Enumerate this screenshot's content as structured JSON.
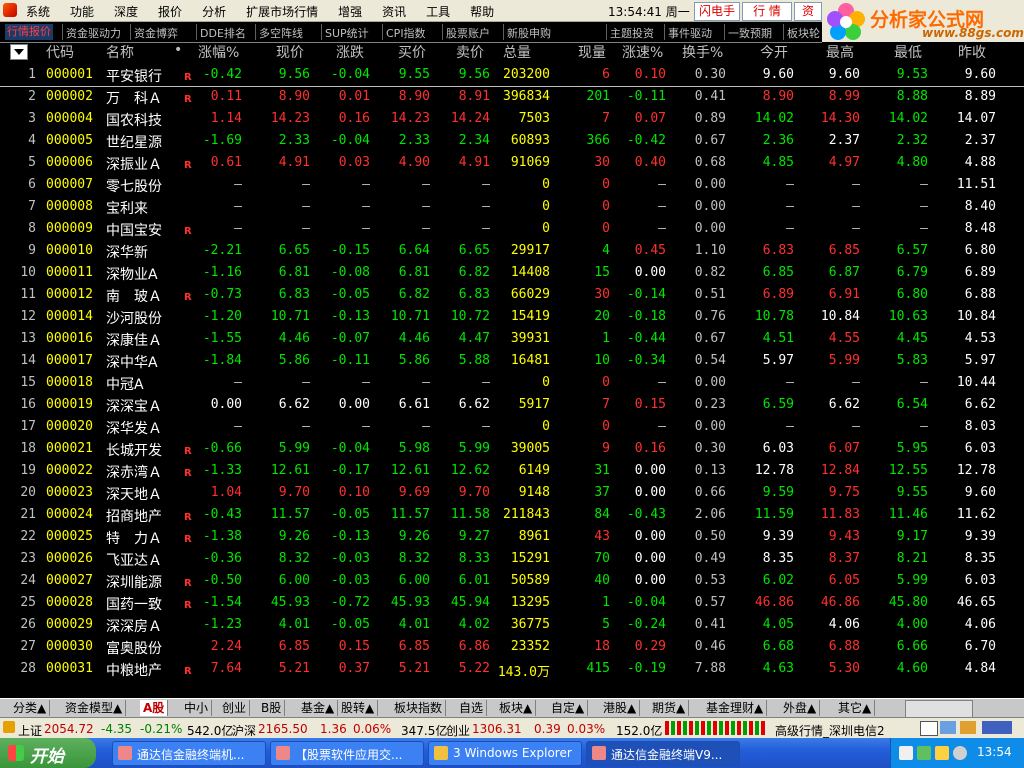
{
  "app": {
    "menu": [
      "系统",
      "功能",
      "深度",
      "报价",
      "分析",
      "扩展市场行情",
      "增强",
      "资讯",
      "工具",
      "帮助"
    ],
    "clock": "13:54:41 周一",
    "quick_buttons": [
      "闪电手",
      "行 情",
      "资"
    ],
    "brand_title": "分析家公式网",
    "brand_url": "www.88gs.com"
  },
  "subtabs": [
    {
      "label": "行情报价",
      "active": true
    },
    {
      "label": "资金驱动力"
    },
    {
      "label": "资金博弈"
    },
    {
      "label": "DDE排名"
    },
    {
      "label": "多空阵线"
    },
    {
      "label": "SUP统计"
    },
    {
      "label": "CPI指数"
    },
    {
      "label": "股票账户"
    },
    {
      "label": "新股申购"
    },
    {
      "label": "主题投资"
    },
    {
      "label": "事件驱动"
    },
    {
      "label": "一致预期"
    },
    {
      "label": "板块轮"
    }
  ],
  "columns": [
    "代码",
    "名称",
    "•",
    "涨幅%",
    "现价",
    "涨跌",
    "买价",
    "卖价",
    "总量",
    "现量",
    "涨速%",
    "换手%",
    "今开",
    "最高",
    "最低",
    "昨收"
  ],
  "rows": [
    {
      "no": "1",
      "code": "000001",
      "name": "平安银行",
      "r": true,
      "chg_pct": "-0.42",
      "price": "9.56",
      "chg": "-0.04",
      "bid": "9.55",
      "ask": "9.56",
      "vol": "203200",
      "cur": "6",
      "speed": "0.10",
      "turn": "0.30",
      "open": "9.60",
      "high": "9.60",
      "low": "9.53",
      "prev": "9.60",
      "dir": "dn",
      "open_c": "eq",
      "high_c": "eq",
      "low_c": "dn",
      "cur_c": "up",
      "speed_c": "up",
      "selected": true
    },
    {
      "no": "2",
      "code": "000002",
      "name": "万　科Ａ",
      "r": true,
      "chg_pct": "0.11",
      "price": "8.90",
      "chg": "0.01",
      "bid": "8.90",
      "ask": "8.91",
      "vol": "396834",
      "cur": "201",
      "speed": "-0.11",
      "turn": "0.41",
      "open": "8.90",
      "high": "8.99",
      "low": "8.88",
      "prev": "8.89",
      "dir": "up",
      "open_c": "up",
      "high_c": "up",
      "low_c": "dn",
      "cur_c": "dn",
      "speed_c": "dn"
    },
    {
      "no": "3",
      "code": "000004",
      "name": "国农科技",
      "r": false,
      "chg_pct": "1.14",
      "price": "14.23",
      "chg": "0.16",
      "bid": "14.23",
      "ask": "14.24",
      "vol": "7503",
      "cur": "7",
      "speed": "0.07",
      "turn": "0.89",
      "open": "14.02",
      "high": "14.30",
      "low": "14.02",
      "prev": "14.07",
      "dir": "up",
      "open_c": "dn",
      "high_c": "up",
      "low_c": "dn",
      "cur_c": "up",
      "speed_c": "up"
    },
    {
      "no": "4",
      "code": "000005",
      "name": "世纪星源",
      "r": false,
      "chg_pct": "-1.69",
      "price": "2.33",
      "chg": "-0.04",
      "bid": "2.33",
      "ask": "2.34",
      "vol": "60893",
      "cur": "366",
      "speed": "-0.42",
      "turn": "0.67",
      "open": "2.36",
      "high": "2.37",
      "low": "2.32",
      "prev": "2.37",
      "dir": "dn",
      "open_c": "dn",
      "high_c": "eq",
      "low_c": "dn",
      "cur_c": "dn",
      "speed_c": "dn"
    },
    {
      "no": "5",
      "code": "000006",
      "name": "深振业Ａ",
      "r": true,
      "chg_pct": "0.61",
      "price": "4.91",
      "chg": "0.03",
      "bid": "4.90",
      "ask": "4.91",
      "vol": "91069",
      "cur": "30",
      "speed": "0.40",
      "turn": "0.68",
      "open": "4.85",
      "high": "4.97",
      "low": "4.80",
      "prev": "4.88",
      "dir": "up",
      "open_c": "dn",
      "high_c": "up",
      "low_c": "dn",
      "cur_c": "up",
      "speed_c": "up"
    },
    {
      "no": "6",
      "code": "000007",
      "name": "零七股份",
      "r": false,
      "chg_pct": "–",
      "price": "–",
      "chg": "–",
      "bid": "–",
      "ask": "–",
      "vol": "0",
      "cur": "0",
      "speed": "–",
      "turn": "0.00",
      "open": "–",
      "high": "–",
      "low": "–",
      "prev": "11.51",
      "dir": "na",
      "cur_c": "up"
    },
    {
      "no": "7",
      "code": "000008",
      "name": "宝利来",
      "r": false,
      "chg_pct": "–",
      "price": "–",
      "chg": "–",
      "bid": "–",
      "ask": "–",
      "vol": "0",
      "cur": "0",
      "speed": "–",
      "turn": "0.00",
      "open": "–",
      "high": "–",
      "low": "–",
      "prev": "8.40",
      "dir": "na",
      "cur_c": "up"
    },
    {
      "no": "8",
      "code": "000009",
      "name": "中国宝安",
      "r": true,
      "chg_pct": "–",
      "price": "–",
      "chg": "–",
      "bid": "–",
      "ask": "–",
      "vol": "0",
      "cur": "0",
      "speed": "–",
      "turn": "0.00",
      "open": "–",
      "high": "–",
      "low": "–",
      "prev": "8.48",
      "dir": "na",
      "cur_c": "up"
    },
    {
      "no": "9",
      "code": "000010",
      "name": "深华新",
      "r": false,
      "chg_pct": "-2.21",
      "price": "6.65",
      "chg": "-0.15",
      "bid": "6.64",
      "ask": "6.65",
      "vol": "29917",
      "cur": "4",
      "speed": "0.45",
      "turn": "1.10",
      "open": "6.83",
      "high": "6.85",
      "low": "6.57",
      "prev": "6.80",
      "dir": "dn",
      "open_c": "up",
      "high_c": "up",
      "low_c": "dn",
      "cur_c": "dn",
      "speed_c": "up"
    },
    {
      "no": "10",
      "code": "000011",
      "name": "深物业A",
      "r": false,
      "chg_pct": "-1.16",
      "price": "6.81",
      "chg": "-0.08",
      "bid": "6.81",
      "ask": "6.82",
      "vol": "14408",
      "cur": "15",
      "speed": "0.00",
      "turn": "0.82",
      "open": "6.85",
      "high": "6.87",
      "low": "6.79",
      "prev": "6.89",
      "dir": "dn",
      "open_c": "dn",
      "high_c": "dn",
      "low_c": "dn",
      "cur_c": "dn",
      "speed_c": "eq"
    },
    {
      "no": "11",
      "code": "000012",
      "name": "南　玻Ａ",
      "r": true,
      "chg_pct": "-0.73",
      "price": "6.83",
      "chg": "-0.05",
      "bid": "6.82",
      "ask": "6.83",
      "vol": "66029",
      "cur": "30",
      "speed": "-0.14",
      "turn": "0.51",
      "open": "6.89",
      "high": "6.91",
      "low": "6.80",
      "prev": "6.88",
      "dir": "dn",
      "open_c": "up",
      "high_c": "up",
      "low_c": "dn",
      "cur_c": "up",
      "speed_c": "dn"
    },
    {
      "no": "12",
      "code": "000014",
      "name": "沙河股份",
      "r": false,
      "chg_pct": "-1.20",
      "price": "10.71",
      "chg": "-0.13",
      "bid": "10.71",
      "ask": "10.72",
      "vol": "15419",
      "cur": "20",
      "speed": "-0.18",
      "turn": "0.76",
      "open": "10.78",
      "high": "10.84",
      "low": "10.63",
      "prev": "10.84",
      "dir": "dn",
      "open_c": "dn",
      "high_c": "eq",
      "low_c": "dn",
      "cur_c": "dn",
      "speed_c": "dn"
    },
    {
      "no": "13",
      "code": "000016",
      "name": "深康佳Ａ",
      "r": false,
      "chg_pct": "-1.55",
      "price": "4.46",
      "chg": "-0.07",
      "bid": "4.46",
      "ask": "4.47",
      "vol": "39931",
      "cur": "1",
      "speed": "-0.44",
      "turn": "0.67",
      "open": "4.51",
      "high": "4.55",
      "low": "4.45",
      "prev": "4.53",
      "dir": "dn",
      "open_c": "dn",
      "high_c": "up",
      "low_c": "dn",
      "cur_c": "dn",
      "speed_c": "dn"
    },
    {
      "no": "14",
      "code": "000017",
      "name": "深中华A",
      "r": false,
      "chg_pct": "-1.84",
      "price": "5.86",
      "chg": "-0.11",
      "bid": "5.86",
      "ask": "5.88",
      "vol": "16481",
      "cur": "10",
      "speed": "-0.34",
      "turn": "0.54",
      "open": "5.97",
      "high": "5.99",
      "low": "5.83",
      "prev": "5.97",
      "dir": "dn",
      "open_c": "eq",
      "high_c": "up",
      "low_c": "dn",
      "cur_c": "dn",
      "speed_c": "dn"
    },
    {
      "no": "15",
      "code": "000018",
      "name": "中冠A",
      "r": false,
      "chg_pct": "–",
      "price": "–",
      "chg": "–",
      "bid": "–",
      "ask": "–",
      "vol": "0",
      "cur": "0",
      "speed": "–",
      "turn": "0.00",
      "open": "–",
      "high": "–",
      "low": "–",
      "prev": "10.44",
      "dir": "na",
      "cur_c": "up"
    },
    {
      "no": "16",
      "code": "000019",
      "name": "深深宝Ａ",
      "r": false,
      "chg_pct": "0.00",
      "price": "6.62",
      "chg": "0.00",
      "bid": "6.61",
      "ask": "6.62",
      "vol": "5917",
      "cur": "7",
      "speed": "0.15",
      "turn": "0.23",
      "open": "6.59",
      "high": "6.62",
      "low": "6.54",
      "prev": "6.62",
      "dir": "eq",
      "open_c": "dn",
      "high_c": "eq",
      "low_c": "dn",
      "cur_c": "up",
      "speed_c": "up"
    },
    {
      "no": "17",
      "code": "000020",
      "name": "深华发Ａ",
      "r": false,
      "chg_pct": "–",
      "price": "–",
      "chg": "–",
      "bid": "–",
      "ask": "–",
      "vol": "0",
      "cur": "0",
      "speed": "–",
      "turn": "0.00",
      "open": "–",
      "high": "–",
      "low": "–",
      "prev": "8.03",
      "dir": "na",
      "cur_c": "up"
    },
    {
      "no": "18",
      "code": "000021",
      "name": "长城开发",
      "r": true,
      "chg_pct": "-0.66",
      "price": "5.99",
      "chg": "-0.04",
      "bid": "5.98",
      "ask": "5.99",
      "vol": "39005",
      "cur": "9",
      "speed": "0.16",
      "turn": "0.30",
      "open": "6.03",
      "high": "6.07",
      "low": "5.95",
      "prev": "6.03",
      "dir": "dn",
      "open_c": "eq",
      "high_c": "up",
      "low_c": "dn",
      "cur_c": "up",
      "speed_c": "up"
    },
    {
      "no": "19",
      "code": "000022",
      "name": "深赤湾Ａ",
      "r": true,
      "chg_pct": "-1.33",
      "price": "12.61",
      "chg": "-0.17",
      "bid": "12.61",
      "ask": "12.62",
      "vol": "6149",
      "cur": "31",
      "speed": "0.00",
      "turn": "0.13",
      "open": "12.78",
      "high": "12.84",
      "low": "12.55",
      "prev": "12.78",
      "dir": "dn",
      "open_c": "eq",
      "high_c": "up",
      "low_c": "dn",
      "cur_c": "dn",
      "speed_c": "eq"
    },
    {
      "no": "20",
      "code": "000023",
      "name": "深天地Ａ",
      "r": false,
      "chg_pct": "1.04",
      "price": "9.70",
      "chg": "0.10",
      "bid": "9.69",
      "ask": "9.70",
      "vol": "9148",
      "cur": "37",
      "speed": "0.00",
      "turn": "0.66",
      "open": "9.59",
      "high": "9.75",
      "low": "9.55",
      "prev": "9.60",
      "dir": "up",
      "open_c": "dn",
      "high_c": "up",
      "low_c": "dn",
      "cur_c": "dn",
      "speed_c": "eq"
    },
    {
      "no": "21",
      "code": "000024",
      "name": "招商地产",
      "r": true,
      "chg_pct": "-0.43",
      "price": "11.57",
      "chg": "-0.05",
      "bid": "11.57",
      "ask": "11.58",
      "vol": "211843",
      "cur": "84",
      "speed": "-0.43",
      "turn": "2.06",
      "open": "11.59",
      "high": "11.83",
      "low": "11.46",
      "prev": "11.62",
      "dir": "dn",
      "open_c": "dn",
      "high_c": "up",
      "low_c": "dn",
      "cur_c": "dn",
      "speed_c": "dn"
    },
    {
      "no": "22",
      "code": "000025",
      "name": "特　力Ａ",
      "r": true,
      "chg_pct": "-1.38",
      "price": "9.26",
      "chg": "-0.13",
      "bid": "9.26",
      "ask": "9.27",
      "vol": "8961",
      "cur": "43",
      "speed": "0.00",
      "turn": "0.50",
      "open": "9.39",
      "high": "9.43",
      "low": "9.17",
      "prev": "9.39",
      "dir": "dn",
      "open_c": "eq",
      "high_c": "up",
      "low_c": "dn",
      "cur_c": "up",
      "speed_c": "eq"
    },
    {
      "no": "23",
      "code": "000026",
      "name": "飞亚达Ａ",
      "r": false,
      "chg_pct": "-0.36",
      "price": "8.32",
      "chg": "-0.03",
      "bid": "8.32",
      "ask": "8.33",
      "vol": "15291",
      "cur": "70",
      "speed": "0.00",
      "turn": "0.49",
      "open": "8.35",
      "high": "8.37",
      "low": "8.21",
      "prev": "8.35",
      "dir": "dn",
      "open_c": "eq",
      "high_c": "up",
      "low_c": "dn",
      "cur_c": "dn",
      "speed_c": "eq"
    },
    {
      "no": "24",
      "code": "000027",
      "name": "深圳能源",
      "r": true,
      "chg_pct": "-0.50",
      "price": "6.00",
      "chg": "-0.03",
      "bid": "6.00",
      "ask": "6.01",
      "vol": "50589",
      "cur": "40",
      "speed": "0.00",
      "turn": "0.53",
      "open": "6.02",
      "high": "6.05",
      "low": "5.99",
      "prev": "6.03",
      "dir": "dn",
      "open_c": "dn",
      "high_c": "up",
      "low_c": "dn",
      "cur_c": "dn",
      "speed_c": "eq"
    },
    {
      "no": "25",
      "code": "000028",
      "name": "国药一致",
      "r": true,
      "chg_pct": "-1.54",
      "price": "45.93",
      "chg": "-0.72",
      "bid": "45.93",
      "ask": "45.94",
      "vol": "13295",
      "cur": "1",
      "speed": "-0.04",
      "turn": "0.57",
      "open": "46.86",
      "high": "46.86",
      "low": "45.80",
      "prev": "46.65",
      "dir": "dn",
      "open_c": "up",
      "high_c": "up",
      "low_c": "dn",
      "cur_c": "dn",
      "speed_c": "dn"
    },
    {
      "no": "26",
      "code": "000029",
      "name": "深深房Ａ",
      "r": false,
      "chg_pct": "-1.23",
      "price": "4.01",
      "chg": "-0.05",
      "bid": "4.01",
      "ask": "4.02",
      "vol": "36775",
      "cur": "5",
      "speed": "-0.24",
      "turn": "0.41",
      "open": "4.05",
      "high": "4.06",
      "low": "4.00",
      "prev": "4.06",
      "dir": "dn",
      "open_c": "dn",
      "high_c": "eq",
      "low_c": "dn",
      "cur_c": "dn",
      "speed_c": "dn"
    },
    {
      "no": "27",
      "code": "000030",
      "name": "富奥股份",
      "r": false,
      "chg_pct": "2.24",
      "price": "6.85",
      "chg": "0.15",
      "bid": "6.85",
      "ask": "6.86",
      "vol": "23352",
      "cur": "18",
      "speed": "0.29",
      "turn": "0.46",
      "open": "6.68",
      "high": "6.88",
      "low": "6.66",
      "prev": "6.70",
      "dir": "up",
      "open_c": "dn",
      "high_c": "up",
      "low_c": "dn",
      "cur_c": "up",
      "speed_c": "up"
    },
    {
      "no": "28",
      "code": "000031",
      "name": "中粮地产",
      "r": true,
      "chg_pct": "7.64",
      "price": "5.21",
      "chg": "0.37",
      "bid": "5.21",
      "ask": "5.22",
      "vol": "143.0万",
      "cur": "415",
      "speed": "-0.19",
      "turn": "7.88",
      "open": "4.63",
      "high": "5.30",
      "low": "4.60",
      "prev": "4.84",
      "dir": "up",
      "open_c": "dn",
      "high_c": "up",
      "low_c": "dn",
      "cur_c": "dn",
      "speed_c": "dn"
    }
  ],
  "bottom_tabs": [
    "分类▲",
    "资金模型▲",
    "A股",
    "中小",
    "创业",
    "B股",
    "基金▲",
    "股转▲",
    "板块指数",
    "自选",
    "板块▲",
    "自定▲",
    "港股▲",
    "期货▲",
    "基金理财▲",
    "外盘▲",
    "其它▲"
  ],
  "index_bar": {
    "sh_label": "上证",
    "sh_val": "2054.72",
    "sh_chg": "-4.35",
    "sh_pct": "-0.21%",
    "sh_amt": "542.0亿",
    "sz_label": "沪深",
    "sz_val": "2165.50",
    "sz_chg": "1.36",
    "sz_pct": "0.06%",
    "sz_amt": "347.5亿",
    "cy_label": "创业",
    "cy_val": "1306.31",
    "cy_chg": "0.39",
    "cy_pct": "0.03%",
    "cy_amt": "152.0亿",
    "server": "高级行情_深圳电信2"
  },
  "taskbar": {
    "start": "开始",
    "tasks": [
      "通达信金融终端机...",
      "【股票软件应用交...",
      "3 Windows Explorer",
      "通达信金融终端V9..."
    ],
    "time": "13:54"
  },
  "colors": {
    "up": "#ff3030",
    "down": "#00e600",
    "neutral": "#ffffff",
    "code": "#ffff00",
    "name": "#ffffff",
    "vol": "#ffff00",
    "turn": "#c0c0c0"
  }
}
